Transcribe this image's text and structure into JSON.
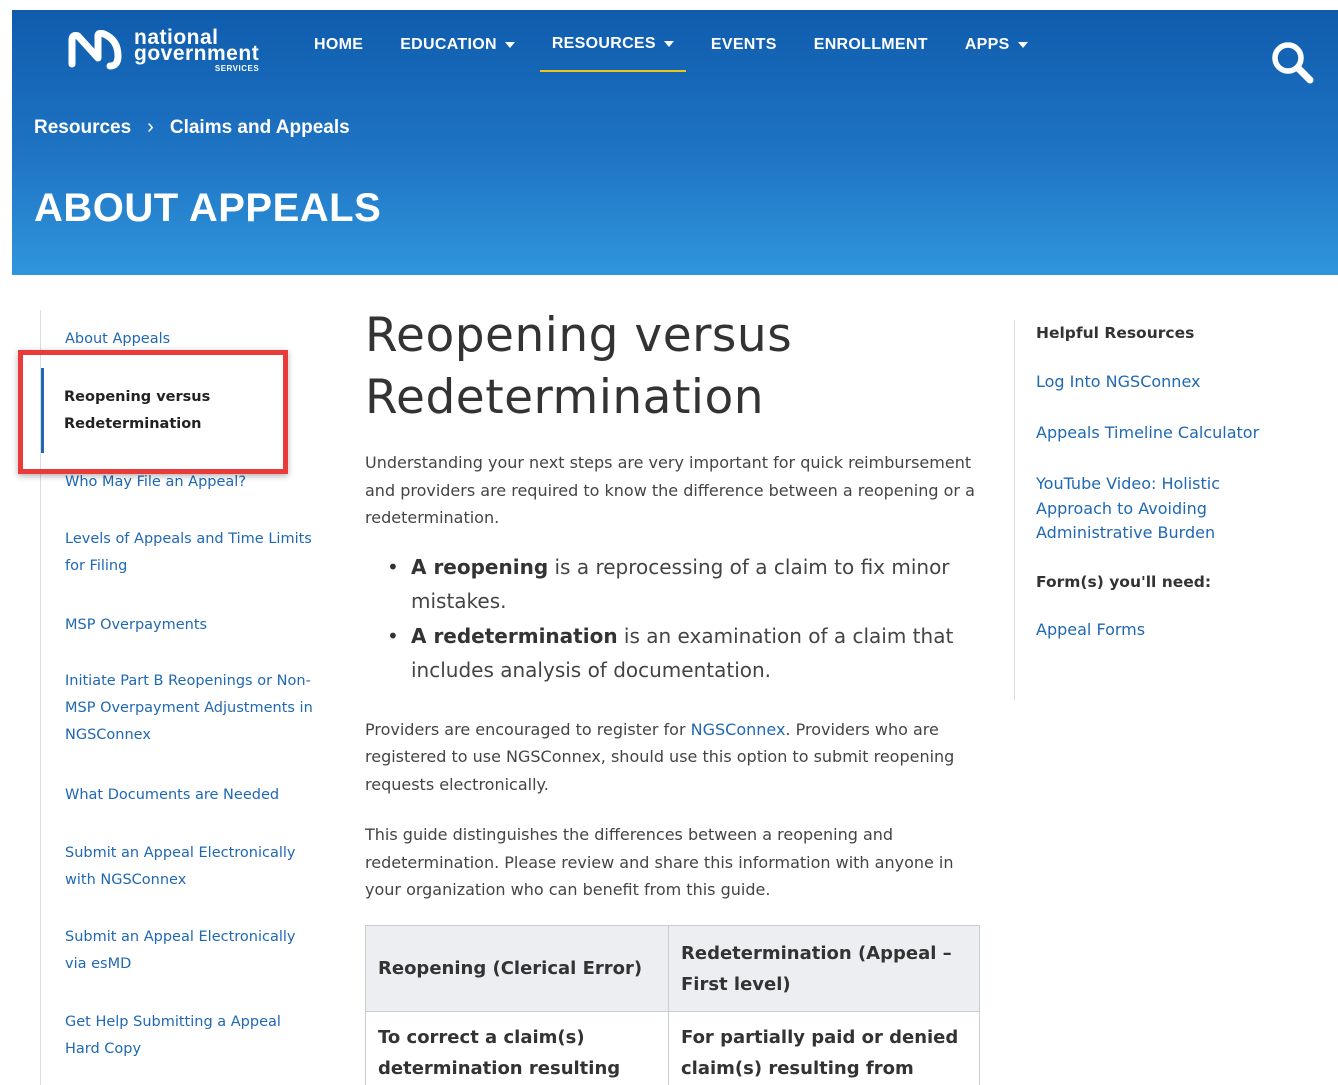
{
  "header": {
    "logo": {
      "line1": "national",
      "line2": "government",
      "line3": "SERVICES"
    },
    "nav": [
      {
        "label": "HOME",
        "has_dropdown": false,
        "active": false
      },
      {
        "label": "EDUCATION",
        "has_dropdown": true,
        "active": false
      },
      {
        "label": "RESOURCES",
        "has_dropdown": true,
        "active": true
      },
      {
        "label": "EVENTS",
        "has_dropdown": false,
        "active": false
      },
      {
        "label": "ENROLLMENT",
        "has_dropdown": false,
        "active": false
      },
      {
        "label": "APPS",
        "has_dropdown": true,
        "active": false
      }
    ],
    "search_icon": "search-icon",
    "breadcrumb": {
      "items": [
        "Resources",
        "Claims and Appeals"
      ],
      "separator": "›"
    },
    "page_title": "ABOUT APPEALS"
  },
  "sidebar": {
    "items": [
      {
        "label": "About Appeals"
      },
      {
        "label": "Reopening versus Redetermination",
        "active": true
      },
      {
        "label": "Who May File an Appeal?"
      },
      {
        "label": "Levels of Appeals and Time Limits for Filing"
      },
      {
        "label": "MSP Overpayments"
      },
      {
        "label": "Initiate Part B Reopenings or Non-MSP Overpayment Adjustments in NGSConnex"
      },
      {
        "label": "What Documents are Needed"
      },
      {
        "label": "Submit an Appeal Electronically with NGSConnex"
      },
      {
        "label": "Submit an Appeal Electronically via esMD"
      },
      {
        "label": "Get Help Submitting a Appeal Hard Copy"
      }
    ]
  },
  "main": {
    "heading": "Reopening versus Redetermination",
    "intro": "Understanding your next steps are very important for quick reimbursement and providers are required to know the difference between a reopening or a redetermination.",
    "bullets": [
      {
        "term": "A reopening",
        "text": " is a reprocessing of a claim to fix minor mistakes."
      },
      {
        "term": "A redetermination",
        "text": " is an examination of a claim that includes analysis of documentation."
      }
    ],
    "para2": {
      "before": "Providers are encouraged to register for ",
      "link": "NGSConnex",
      "after": ". Providers who are registered to use NGSConnex, should use this option to submit reopening requests electronically."
    },
    "para3": "This guide distinguishes the differences between a reopening and redetermination. Please review and share this information with anyone in your organization who can benefit from this guide.",
    "table": {
      "headers": [
        "Reopening (Clerical Error)",
        "Redetermination (Appeal – First level)"
      ],
      "rows": [
        [
          "To correct a claim(s) determination resulting from",
          "For partially paid or denied claim(s) resulting from more"
        ]
      ]
    }
  },
  "right_sidebar": {
    "heading": "Helpful Resources",
    "links": [
      "Log Into NGSConnex",
      "Appeals Timeline Calculator",
      "YouTube Video: Holistic Approach to Avoiding Administrative Burden"
    ],
    "forms_heading": "Form(s) you'll need:",
    "forms_links": [
      "Appeal Forms"
    ]
  },
  "colors": {
    "header_top": "#0f5cad",
    "header_bottom": "#2f96dc",
    "link": "#1f68b3",
    "active_underline": "#f0c419",
    "highlight": "#ea3b3b"
  }
}
